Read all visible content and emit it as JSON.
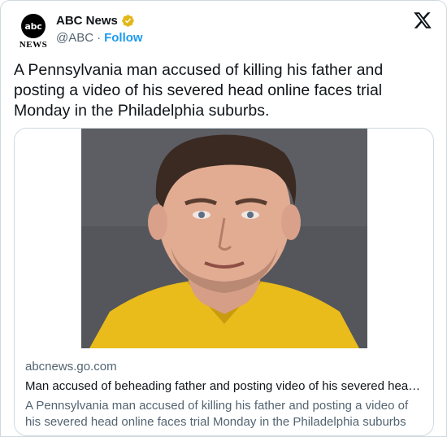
{
  "author": {
    "avatar_logo_text": "abc",
    "avatar_news_text": "NEWS",
    "display_name": "ABC News",
    "handle": "@ABC",
    "separator": "·",
    "follow_label": "Follow",
    "verified_color": "#e2b719"
  },
  "platform": {
    "logo": "𝕏",
    "logo_icon": "x-logo-icon"
  },
  "tweet": {
    "text": "A Pennsylvania man accused of killing his father and posting a video of his severed head online faces trial Monday in the Philadelphia suburbs."
  },
  "link_card": {
    "domain": "abcnews.go.com",
    "title": "Man accused of beheading father and posting video of his severed hea…",
    "description": "A Pennsylvania man accused of killing his father and posting a video of his severed head online faces trial Monday in the Philadelphia suburbs"
  },
  "colors": {
    "accent": "#1d9bf0",
    "secondary_text": "#536471",
    "border": "#cfd9de"
  }
}
